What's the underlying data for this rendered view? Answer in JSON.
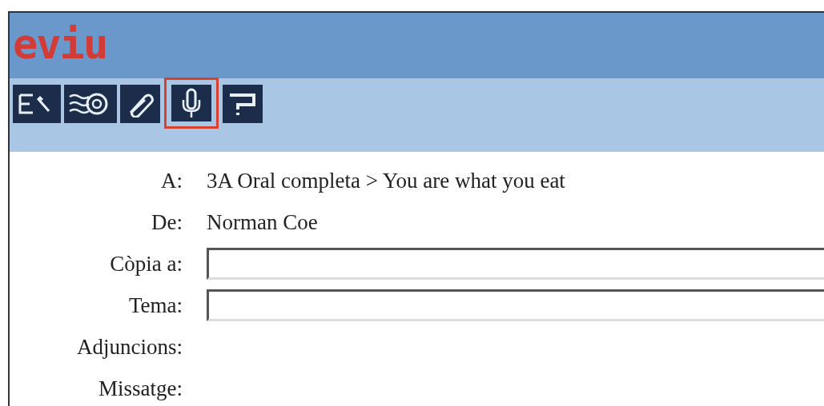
{
  "logo": "eviu",
  "toolbar": [
    {
      "kind": "compose",
      "selected": false
    },
    {
      "kind": "stamp",
      "selected": false
    },
    {
      "kind": "attach",
      "selected": false
    },
    {
      "kind": "microphone",
      "selected": true
    },
    {
      "kind": "help",
      "selected": false
    }
  ],
  "fields": [
    {
      "kind": "text",
      "label": "A:",
      "value": "3A Oral completa > You are what you eat"
    },
    {
      "kind": "text",
      "label": "De:",
      "value": "Norman Coe"
    },
    {
      "kind": "input",
      "label": "Còpia a:"
    },
    {
      "kind": "input",
      "label": "Tema:"
    },
    {
      "kind": "text",
      "label": "Adjuncions:"
    },
    {
      "kind": "text",
      "label": "Missatge:"
    }
  ]
}
